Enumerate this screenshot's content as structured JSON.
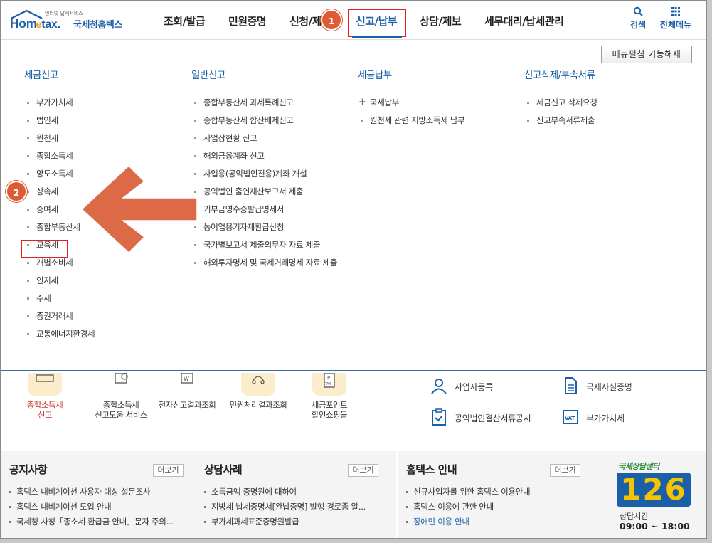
{
  "header": {
    "logo": {
      "tagline": "인터넷 납세서비스",
      "wordmark": "Hometax",
      "name": "국세청홈택스"
    },
    "nav": [
      "조회/발급",
      "민원증명",
      "신청/제출",
      "신고/납부",
      "상담/제보",
      "세무대리/납세관리"
    ],
    "active_nav": "신고/납부",
    "search_label": "검색",
    "allmenu_label": "전체메뉴"
  },
  "callouts": {
    "step1": "1",
    "step2": "2"
  },
  "mega_menu": {
    "collapse_button": "메뉴펼침 기능해제",
    "columns": [
      {
        "title": "세금신고",
        "items": [
          "부가가치세",
          "법인세",
          "원천세",
          "종합소득세",
          "양도소득세",
          "상속세",
          "증여세",
          "종합부동산세",
          "교육세",
          "개별소비세",
          "인지세",
          "주세",
          "증권거래세",
          "교통에너지환경세"
        ]
      },
      {
        "title": "일반신고",
        "items": [
          "종합부동산세 과세특례신고",
          "종합부동산세 합산배제신고",
          "사업장현황 신고",
          "해외금융계좌 신고",
          "사업용(공익법인전용)계좌 개설",
          "공익법인 출연재산보고서 제출",
          "기부금영수증발급명세서",
          "농어업용기자재환급신청",
          "국가별보고서 제출의무자 자료 제출",
          "해외투자명세 및 국제거래명세 자료 제출"
        ]
      },
      {
        "title": "세금납부",
        "items": [
          "국세납부",
          "원천세 관련 지방소득세 납부"
        ]
      },
      {
        "title": "신고삭제/부속서류",
        "items": [
          "세금신고 삭제요청",
          "신고부속서류제출"
        ]
      }
    ],
    "highlighted_item": "증여세"
  },
  "quick_icons": [
    {
      "label": "종합소득세\n신고"
    },
    {
      "label": "종합소득세\n신고도움 서비스"
    },
    {
      "label": "전자신고결과조회"
    },
    {
      "label": "민원처리결과조회"
    },
    {
      "label": "세금포인트\n할인쇼핑몰"
    }
  ],
  "right_links": [
    "사업자등록",
    "국세사실증명",
    "공익법인결산서류공시",
    "부가가치세"
  ],
  "news": {
    "more_label": "더보기",
    "sections": [
      {
        "title": "공지사항",
        "items": [
          "홈택스 내비게이션 사용자 대상 설문조사",
          "홈택스 내비게이션 도입 안내",
          "국세청 사칭「종소세 환급금 안내」문자 주의..."
        ]
      },
      {
        "title": "상담사례",
        "items": [
          "소득금액 증명원에 대하여",
          "지방세 납세증명서[완납증명] 발행 경로좀 알...",
          "부가세과세표준증명원발급"
        ]
      },
      {
        "title": "홈택스 안내",
        "items": [
          "신규사업자를 위한 홈택스 이용안내",
          "홈택스 이용에 관한 안내",
          "장애인 이용 안내"
        ]
      }
    ]
  },
  "call_center": {
    "title": "국세상담센터",
    "number": "126",
    "hours_label": "상담시간",
    "hours": "09:00 ~ 18:00"
  },
  "colors": {
    "brand": "#1a5fa8",
    "highlight": "#e02020",
    "callout": "#dd5c35"
  }
}
